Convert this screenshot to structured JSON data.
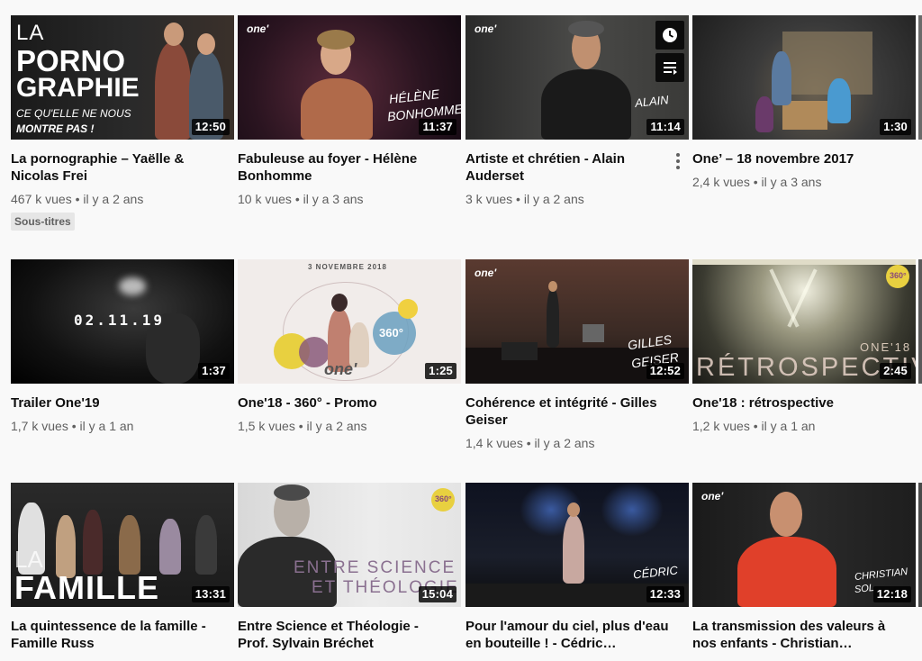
{
  "videos": [
    {
      "title": "La pornographie – Yaëlle & Nicolas Frei",
      "views": "467 k vues",
      "age": "il y a 2 ans",
      "duration": "12:50",
      "badge": "Sous-titres",
      "thumb_text": {
        "line1": "LA",
        "line2": "PORNO",
        "line3": "GRAPHIE",
        "line4": "CE QU'ELLE NE NOUS",
        "line5": "MONTRE PAS !"
      }
    },
    {
      "title": "Fabuleuse au foyer - Hélène Bonhomme",
      "views": "10 k vues",
      "age": "il y a 3 ans",
      "duration": "11:37",
      "thumb_text": {
        "logo": "one'",
        "line1": "HÉLÈNE",
        "line2": "BONHOMME"
      }
    },
    {
      "title": "Artiste et chrétien - Alain Auderset",
      "views": "3 k vues",
      "age": "il y a 2 ans",
      "duration": "11:14",
      "thumb_text": {
        "logo": "one'",
        "line1": "ALAIN"
      }
    },
    {
      "title": "One’ – 18 novembre 2017",
      "views": "2,4 k vues",
      "age": "il y a 3 ans",
      "duration": "1:30"
    },
    {
      "title": "Trailer One'19",
      "views": "1,7 k vues",
      "age": "il y a 1 an",
      "duration": "1:37",
      "thumb_text": {
        "line1": "02.11.19"
      }
    },
    {
      "title": "One'18 - 360° - Promo",
      "views": "1,5 k vues",
      "age": "il y a 2 ans",
      "duration": "1:25",
      "thumb_text": {
        "line1": "3 NOVEMBRE 2018",
        "line2": "360°",
        "logo": "one'"
      }
    },
    {
      "title": "Cohérence et intégrité - Gilles Geiser",
      "views": "1,4 k vues",
      "age": "il y a 2 ans",
      "duration": "12:52",
      "thumb_text": {
        "logo": "one'",
        "line1": "GILLES",
        "line2": "GEISER"
      }
    },
    {
      "title": "One'18 : rétrospective",
      "views": "1,2 k vues",
      "age": "il y a 1 an",
      "duration": "2:45",
      "thumb_text": {
        "line1": "ONE'18",
        "line2": "RÉTROSPECTIVE",
        "line3": "360°"
      }
    },
    {
      "title": "La quintessence de la famille - Famille Russ",
      "views": "",
      "age": "",
      "duration": "13:31",
      "thumb_text": {
        "line1": "LA",
        "line2": "FAMILLE"
      }
    },
    {
      "title": "Entre Science et Théologie - Prof. Sylvain Bréchet",
      "views": "",
      "age": "",
      "duration": "15:04",
      "thumb_text": {
        "line1": "ENTRE SCIENCE",
        "line2": "ET THÉOLOGIE",
        "line3": "360°"
      }
    },
    {
      "title": "Pour l'amour du ciel, plus d'eau en bouteille ! - Cédric…",
      "views": "",
      "age": "",
      "duration": "12:33",
      "thumb_text": {
        "line1": "CÉDRIC"
      }
    },
    {
      "title": "La transmission des valeurs à nos enfants - Christian…",
      "views": "",
      "age": "",
      "duration": "12:18",
      "thumb_text": {
        "logo": "one'",
        "line1": "CHRISTIAN",
        "line2": "SOL"
      }
    }
  ],
  "icons": {
    "watch_later": "clock-icon",
    "add_to_queue": "queue-icon",
    "more": "more-vert-icon"
  },
  "colors": {
    "background": "#f9f9f9",
    "meta_text": "#606060",
    "badge_bg": "#e6e6e6"
  }
}
